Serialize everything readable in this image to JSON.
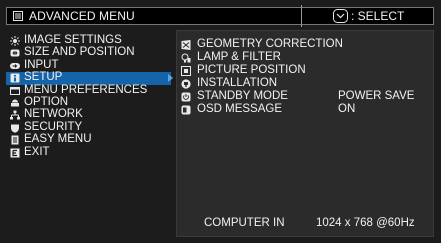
{
  "title": {
    "icon": "menu-icon",
    "text": "ADVANCED MENU"
  },
  "select_hint": {
    "icon": "select-key-icon",
    "text": ": SELECT"
  },
  "menu": [
    {
      "icon": "image-settings-icon",
      "label": "IMAGE SETTINGS"
    },
    {
      "icon": "size-position-icon",
      "label": "SIZE AND POSITION"
    },
    {
      "icon": "input-icon",
      "label": "INPUT"
    },
    {
      "icon": "setup-icon",
      "label": "SETUP",
      "selected": true
    },
    {
      "icon": "menu-preferences-icon",
      "label": "MENU PREFERENCES"
    },
    {
      "icon": "option-icon",
      "label": "OPTION"
    },
    {
      "icon": "network-icon",
      "label": "NETWORK"
    },
    {
      "icon": "security-icon",
      "label": "SECURITY"
    },
    {
      "icon": "easy-menu-icon",
      "label": "EASY MENU"
    },
    {
      "icon": "exit-icon",
      "label": "EXIT"
    }
  ],
  "setup": [
    {
      "icon": "geometry-correction-icon",
      "label": "GEOMETRY CORRECTION",
      "value": ""
    },
    {
      "icon": "lamp-filter-icon",
      "label": "LAMP & FILTER",
      "value": ""
    },
    {
      "icon": "picture-position-icon",
      "label": "PICTURE POSITION",
      "value": ""
    },
    {
      "icon": "installation-icon",
      "label": "INSTALLATION",
      "value": ""
    },
    {
      "icon": "standby-mode-icon",
      "label": "STANDBY MODE",
      "value": "POWER SAVE"
    },
    {
      "icon": "osd-message-icon",
      "label": "OSD MESSAGE",
      "value": "ON"
    }
  ],
  "footer": {
    "source": "COMPUTER IN",
    "resolution": "1024 x 768 @60Hz"
  },
  "colors": {
    "background": "#1c1c1c",
    "panel": "#2b2b2b",
    "highlight": "#1563a8",
    "text": "#f2f2f2"
  }
}
